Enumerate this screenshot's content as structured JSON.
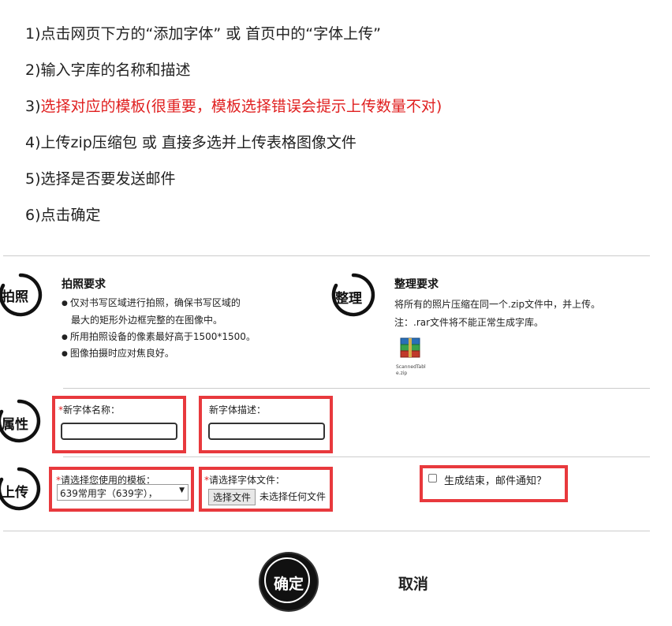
{
  "steps": [
    {
      "num": "1)",
      "text": "点击网页下方的“添加字体” 或 首页中的“字体上传”"
    },
    {
      "num": "2)",
      "text": "输入字库的名称和描述"
    },
    {
      "num": "3)",
      "text": "选择对应的模板(很重要，模板选择错误会提示上传数量不对)"
    },
    {
      "num": "4)",
      "text": "上传zip压缩包 或 直接多选并上传表格图像文件"
    },
    {
      "num": "5)",
      "text": "选择是否要发送邮件"
    },
    {
      "num": "6)",
      "text": "点击确定"
    }
  ],
  "photo": {
    "icon_label": "拍照",
    "title": "拍照要求",
    "lines": [
      "仅对书写区域进行拍照，确保书写区域的",
      "最大的矩形外边框完整的在图像中。",
      "所用拍照设备的像素最好高于1500*1500。",
      "图像拍摄时应对焦良好。"
    ]
  },
  "organize": {
    "icon_label": "整理",
    "title": "整理要求",
    "lines": [
      "将所有的照片压缩在同一个.zip文件中，并上传。",
      "注：.rar文件将不能正常生成字库。"
    ],
    "file_icon_label": "ScannedTable.zip"
  },
  "attributes": {
    "icon_label": "属性",
    "name_label": "新字体名称：",
    "name_required": "*",
    "name_value": "",
    "desc_label": "新字体描述：",
    "desc_value": ""
  },
  "upload": {
    "icon_label": "上传",
    "template_label": "请选择您使用的模板：",
    "template_required": "*",
    "template_selected": "639常用字（639字），",
    "file_label": "请选择字体文件：",
    "file_required": "*",
    "file_button": "选择文件",
    "file_status": "未选择任何文件",
    "email_label": "生成结束，邮件通知？",
    "email_checked": false
  },
  "actions": {
    "confirm": "确定",
    "cancel": "取消"
  },
  "colors": {
    "highlight": "#e8393d",
    "warning_text": "#e02020"
  }
}
